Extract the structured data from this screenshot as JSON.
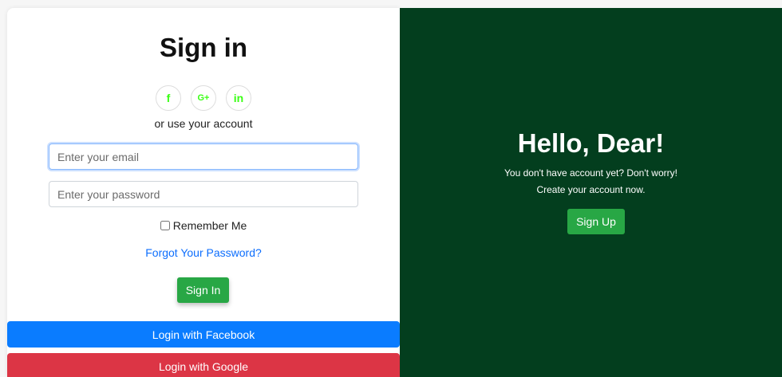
{
  "signin": {
    "title": "Sign in",
    "socials": [
      {
        "icon": "facebook-icon",
        "glyph": "f"
      },
      {
        "icon": "google-plus-icon",
        "glyph": "G+"
      },
      {
        "icon": "linkedin-icon",
        "glyph": "in"
      }
    ],
    "alt_text": "or use your account",
    "email_placeholder": "Enter your email",
    "password_placeholder": "Enter your password",
    "remember_label": "Remember Me",
    "forgot_label": "Forgot Your Password?",
    "signin_button": "Sign In",
    "facebook_button": "Login with Facebook",
    "google_button": "Login with Google"
  },
  "signup": {
    "title": "Hello, Dear!",
    "line1": "You don't have account yet? Don't worry!",
    "line2": "Create your account now.",
    "signup_button": "Sign Up"
  },
  "colors": {
    "right_panel_bg": "#033e1e",
    "social_icon": "#39ff14",
    "green_button": "#28a745",
    "facebook_button": "#0a7cff",
    "google_button": "#dc3545",
    "link": "#0d6efd"
  }
}
